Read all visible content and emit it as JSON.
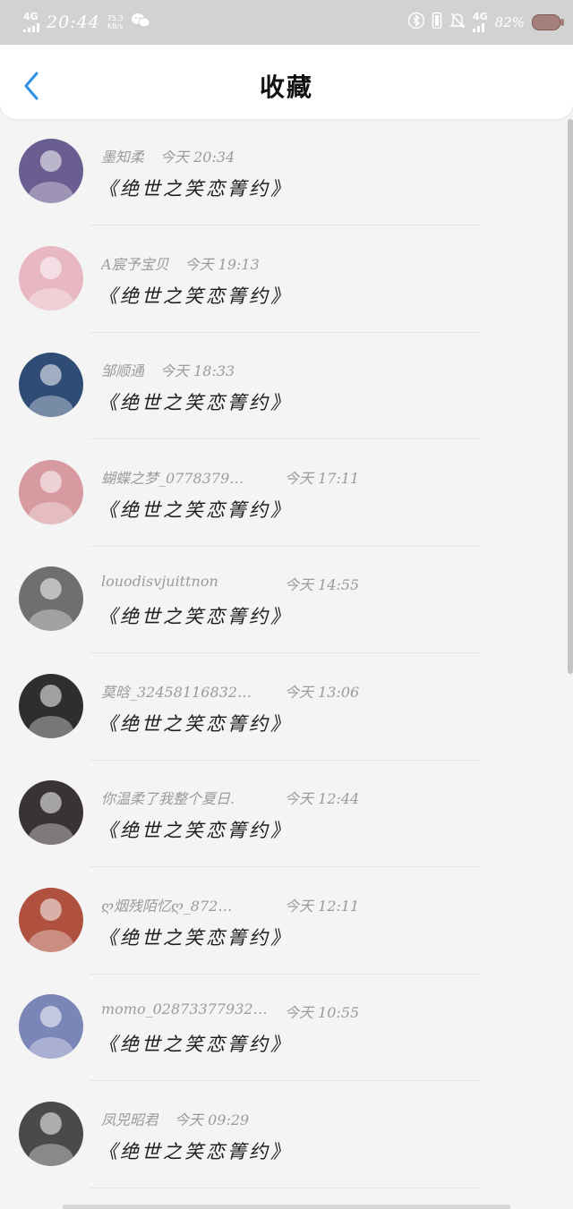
{
  "status_bar": {
    "network": "4G",
    "time": "20:44",
    "speed_value": "75.3",
    "speed_unit": "KB/s",
    "network_right": "4G",
    "battery": "82%"
  },
  "header": {
    "title": "收藏"
  },
  "items": [
    {
      "user": "墨知柔",
      "time": "今天 20:34",
      "title": "《绝世之笑恋箐约》",
      "avatar_color": "#6a5d8f"
    },
    {
      "user": "A宸予宝贝",
      "time": "今天 19:13",
      "title": "《绝世之笑恋箐约》",
      "avatar_color": "#e7b7c2"
    },
    {
      "user": "邹顺通",
      "time": "今天 18:33",
      "title": "《绝世之笑恋箐约》",
      "avatar_color": "#2f4c77"
    },
    {
      "user": "蝴蝶之梦_0778379…",
      "time": "今天 17:11",
      "title": "《绝世之笑恋箐约》",
      "avatar_color": "#d79aa0"
    },
    {
      "user": "louodisvjuittnon",
      "time": "今天 14:55",
      "title": "《绝世之笑恋箐约》",
      "avatar_color": "#6f6f6f"
    },
    {
      "user": "莫晗_32458116832…",
      "time": "今天 13:06",
      "title": "《绝世之笑恋箐约》",
      "avatar_color": "#2e2e2e"
    },
    {
      "user": "你温柔了我整个夏日.",
      "time": "今天 12:44",
      "title": "《绝世之笑恋箐约》",
      "avatar_color": "#3a3336"
    },
    {
      "user": "ღ烟残陌忆ღ_872…",
      "time": "今天 12:11",
      "title": "《绝世之笑恋箐约》",
      "avatar_color": "#b0503e"
    },
    {
      "user": "momo_02873377932…",
      "time": "今天 10:55",
      "title": "《绝世之笑恋箐约》",
      "avatar_color": "#7b86b8"
    },
    {
      "user": "凤兕昭君",
      "time": "今天 09:29",
      "title": "《绝世之笑恋箐约》",
      "avatar_color": "#4a4a4a"
    }
  ]
}
